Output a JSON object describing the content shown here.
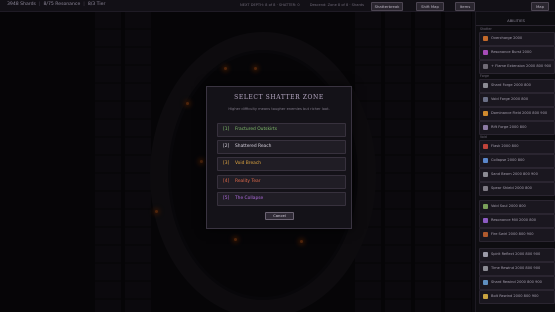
{
  "topbar": {
    "stats": [
      "3948 Shards",
      "8/75 Resonance",
      "8/3 Tier"
    ],
    "status": [
      "NEXT DEPTH: 8 of 8 · SHATTER: 0",
      "Descend: Zone 8 of 8 · Shards"
    ],
    "buttons": [
      "Shatterbreak",
      "Shift Map",
      "Items",
      "Map"
    ]
  },
  "sidebar": {
    "header": "ABILITIES",
    "sections": [
      "Shatter",
      "Forge",
      "Void"
    ],
    "items": [
      {
        "label": "Overcharge 2000",
        "color": "#c46a2a"
      },
      {
        "label": "Resonance Burst 2000",
        "color": "#a74bb8"
      },
      {
        "label": "+ Flame Extension 2000 800 900",
        "color": "#6f6a75"
      },
      {
        "label": "Shard Forge 2000 800",
        "color": "#8b8b93"
      },
      {
        "label": "Void Forge 2000 800",
        "color": "#6a6f86"
      },
      {
        "label": "Dominance Field 2000 800 900",
        "color": "#cf8a2e"
      },
      {
        "label": "Rift Forge 2000 800",
        "color": "#8b7aa3"
      },
      {
        "label": "Flask 2000 800",
        "color": "#c0433a"
      },
      {
        "label": "Collapse 2000 800",
        "color": "#5a86c9"
      },
      {
        "label": "Sand Beam 2000 800 900",
        "color": "#8b8b93"
      },
      {
        "label": "Spear Shield 2000 800",
        "color": "#7e7a84"
      },
      {
        "label": "Void Soul 2000 800",
        "color": "#7aa05a"
      },
      {
        "label": "Resonance Mill 2000 800",
        "color": "#8d5bc4"
      },
      {
        "label": "Fire Swirl 2000 800 900",
        "color": "#b05a2e"
      },
      {
        "label": "Spirit Reflect 2000 800 900",
        "color": "#9b9ba8"
      },
      {
        "label": "Time Rewind 2000 800 900",
        "color": "#8b8b93"
      },
      {
        "label": "Shard Rewind 2000 800 900",
        "color": "#5f8fc0"
      },
      {
        "label": "Bolt Rewind 2000 800 900",
        "color": "#c9a340"
      }
    ]
  },
  "modal": {
    "title": "SELECT SHATTER ZONE",
    "subtitle": "Higher difficulty means tougher enemies but richer loot.",
    "zones": [
      {
        "key": "[1]",
        "name": "Fractured Outskirts",
        "color": "#7fbf6a"
      },
      {
        "key": "[2]",
        "name": "Shattered Reach",
        "color": "#d9d3df"
      },
      {
        "key": "[3]",
        "name": "Void Breach",
        "color": "#e0a640"
      },
      {
        "key": "[4]",
        "name": "Reality Tear",
        "color": "#e26a4a"
      },
      {
        "key": "[5]",
        "name": "The Collapse",
        "color": "#b06ce0"
      }
    ],
    "cancel": "Cancel"
  }
}
